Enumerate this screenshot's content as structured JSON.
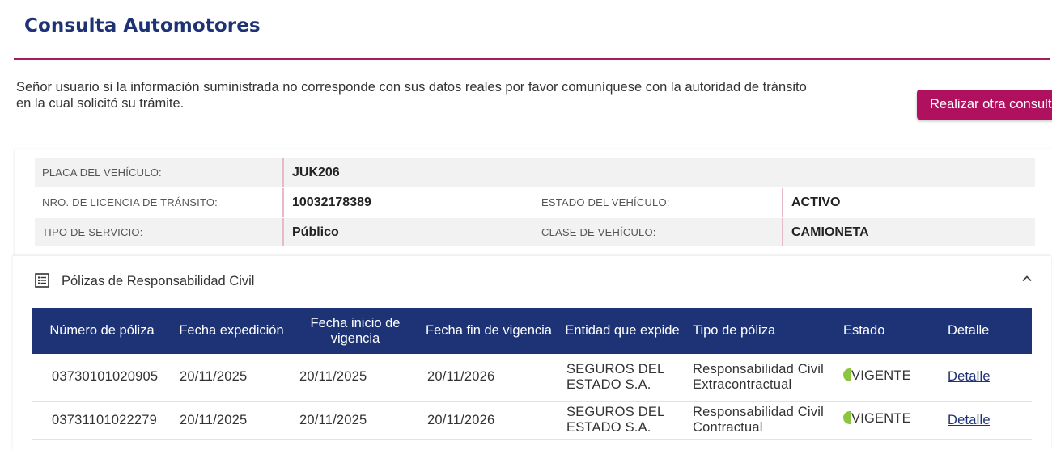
{
  "page": {
    "title": "Consulta Automotores",
    "notice_line1": "Señor usuario si la información suministrada no corresponde con sus datos reales por favor comuníquese con la autoridad de tránsito",
    "notice_line2": "en la cual solicitó su trámite.",
    "new_query_button": "Realizar otra consulta"
  },
  "vehicle": {
    "plate_label": "PLACA DEL VEHÍCULO:",
    "plate_value": "JUK206",
    "license_label": "NRO. DE LICENCIA DE TRÁNSITO:",
    "license_value": "10032178389",
    "status_label": "ESTADO DEL VEHÍCULO:",
    "status_value": "ACTIVO",
    "service_label": "TIPO DE SERVICIO:",
    "service_value": "Público",
    "class_label": "CLASE DE VEHÍCULO:",
    "class_value": "CAMIONETA"
  },
  "policies": {
    "section_title": "Pólizas de Responsabilidad Civil",
    "icons": {
      "section": "list-icon",
      "toggle": "chevron-up-icon"
    },
    "columns": [
      "Número de póliza",
      "Fecha expedición",
      "Fecha inicio de vigencia",
      "Fecha fin de vigencia",
      "Entidad que expide",
      "Tipo de póliza",
      "Estado",
      "Detalle"
    ],
    "rows": [
      {
        "number": "03730101020905",
        "issued": "20/11/2025",
        "start": "20/11/2025",
        "end": "20/11/2026",
        "entity": "SEGUROS DEL ESTADO S.A.",
        "type": "Responsabilidad Civil Extracontractual",
        "status": "VIGENTE",
        "detail": "Detalle"
      },
      {
        "number": "03731101022279",
        "issued": "20/11/2025",
        "start": "20/11/2025",
        "end": "20/11/2026",
        "entity": "SEGUROS DEL ESTADO S.A.",
        "type": "Responsabilidad Civil Contractual",
        "status": "VIGENTE",
        "detail": "Detalle"
      }
    ]
  },
  "colors": {
    "title": "#1d3375",
    "accent": "#b0115e",
    "table_header": "#1d3375",
    "status_ok": "#8cc63f"
  }
}
